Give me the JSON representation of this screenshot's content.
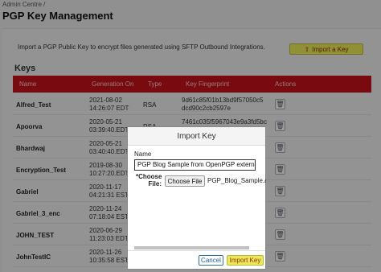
{
  "breadcrumb": "Admin Centre /",
  "page_title": "PGP Key Management",
  "intro_text": "Import a PGP Public Key to encrypt files generated using SFTP Outbound Integrations.",
  "import_key_button": "Import a Key",
  "section_title": "Keys",
  "table": {
    "columns": [
      "Name",
      "Generation On",
      "Type",
      "Key Fingerprint",
      "Actions"
    ],
    "rows": [
      {
        "name": "Alfred_Test",
        "date": "2021-08-02",
        "time": "14:26:07 EDT",
        "type": "RSA",
        "fp1": "9d61c85f01b13bd9f57050c5",
        "fp2": "dcd90c2cb2597e"
      },
      {
        "name": "Apoorva",
        "date": "2020-05-21",
        "time": "03:39:40.EDT",
        "type": "RSA",
        "fp1": "7461c035f5967043e9a3fd5bc",
        "fp2": ""
      },
      {
        "name": "Bhardwaj",
        "date": "2020-05-21",
        "time": "03:40:40.EDT",
        "type": "",
        "fp1": "",
        "fp2": ""
      },
      {
        "name": "Encryption_Test",
        "date": "2019-08-30",
        "time": "10:27:20.EDT",
        "type": "",
        "fp1": "",
        "fp2": ""
      },
      {
        "name": "Gabriel",
        "date": "2020-11-17",
        "time": "04:21:31 EST",
        "type": "",
        "fp1": "",
        "fp2": ""
      },
      {
        "name": "Gabriel_3_enc",
        "date": "2020-11-24",
        "time": "07:18:04 EST",
        "type": "",
        "fp1": "",
        "fp2": ""
      },
      {
        "name": "JOHN_TEST",
        "date": "2020-06-29",
        "time": "11:23:03 EDT",
        "type": "",
        "fp1": "",
        "fp2": ""
      },
      {
        "name": "JohnTestIC",
        "date": "2020-11-26",
        "time": "10:35:58 EST",
        "type": "",
        "fp1": "",
        "fp2": ""
      }
    ]
  },
  "dialog": {
    "title": "Import Key",
    "name_label": "Name",
    "name_value": "PGP Blog Sample from OpenPGP external",
    "file_label_line1": "*Choose",
    "file_label_line2": "File:",
    "choose_button": "Choose File",
    "file_name": "PGP_Blog_Sample.asc",
    "cancel_button": "Cancel",
    "import_button": "Import Key"
  },
  "colors": {
    "table_header": "#c4111a",
    "primary_button": "#e9e95a"
  },
  "icons": {
    "import": "upload-icon",
    "delete": "trash-icon"
  }
}
